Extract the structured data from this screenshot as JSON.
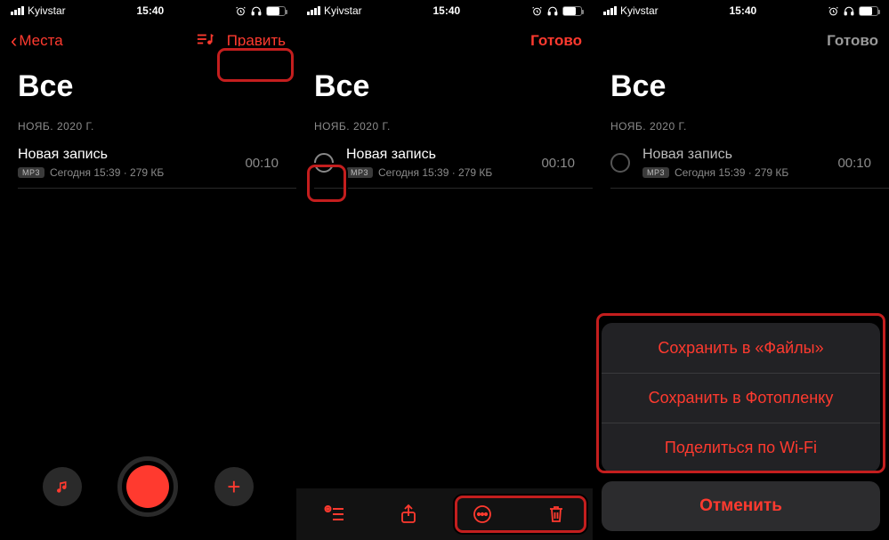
{
  "status": {
    "carrier": "Kyivstar",
    "time": "15:40"
  },
  "accent": "#ff3a2f",
  "p1": {
    "back": "Места",
    "edit": "Править",
    "title": "Все",
    "date": "НОЯБ. 2020 Г.",
    "rec": {
      "name": "Новая запись",
      "badge": "MP3",
      "meta": "Сегодня 15:39 · 279 КБ",
      "dur": "00:10"
    }
  },
  "p2": {
    "done": "Готово",
    "title": "Все",
    "date": "НОЯБ. 2020 Г.",
    "rec": {
      "name": "Новая запись",
      "badge": "MP3",
      "meta": "Сегодня 15:39 · 279 КБ",
      "dur": "00:10"
    }
  },
  "p3": {
    "done": "Готово",
    "title": "Все",
    "date": "НОЯБ. 2020 Г.",
    "rec": {
      "name": "Новая запись",
      "badge": "MP3",
      "meta": "Сегодня 15:39 · 279 КБ",
      "dur": "00:10"
    },
    "sheet": {
      "save_files": "Сохранить в «Файлы»",
      "save_photos": "Сохранить в Фотопленку",
      "share_wifi": "Поделиться по Wi-Fi",
      "cancel": "Отменить"
    }
  }
}
